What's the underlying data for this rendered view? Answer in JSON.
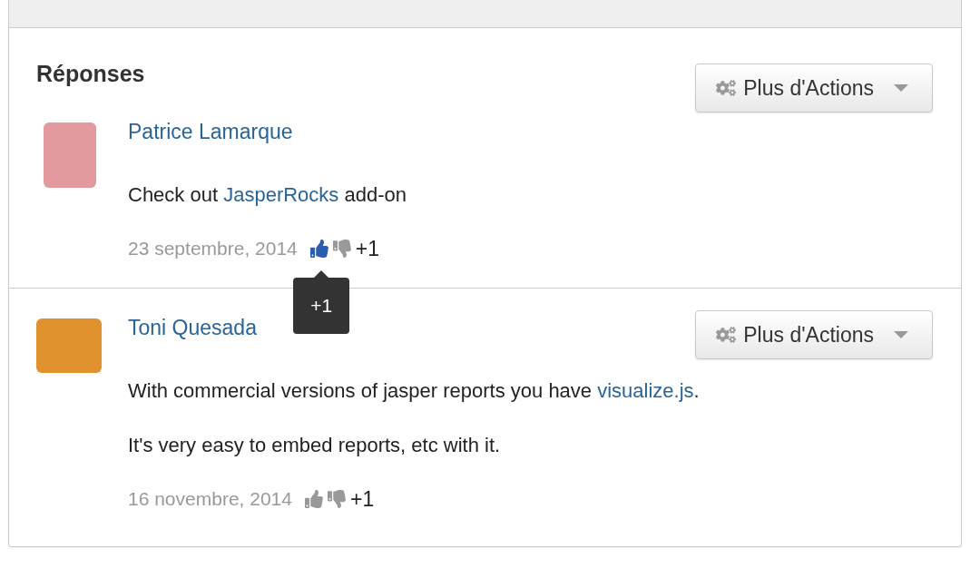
{
  "section_title": "Réponses",
  "header_button": {
    "label": "Plus d'Actions"
  },
  "answers": [
    {
      "author": "Patrice Lamarque",
      "paragraphs": [
        [
          {
            "kind": "text",
            "text": "Check out "
          },
          {
            "kind": "link",
            "text": "JasperRocks"
          },
          {
            "kind": "text",
            "text": " add-on"
          }
        ]
      ],
      "date": "23 septembre, 2014",
      "liked": true,
      "disliked": false,
      "score": "+1",
      "tooltip": "+1"
    },
    {
      "author": "Toni Quesada",
      "actions_button": {
        "label": "Plus d'Actions"
      },
      "paragraphs": [
        [
          {
            "kind": "text",
            "text": "With commercial versions of jasper reports you have "
          },
          {
            "kind": "link",
            "text": "visualize.js"
          },
          {
            "kind": "text",
            "text": "."
          }
        ],
        [
          {
            "kind": "text",
            "text": "It's very easy to embed reports, etc with it."
          }
        ]
      ],
      "date": "16 novembre, 2014",
      "liked": false,
      "disliked": false,
      "score": "+1"
    }
  ]
}
